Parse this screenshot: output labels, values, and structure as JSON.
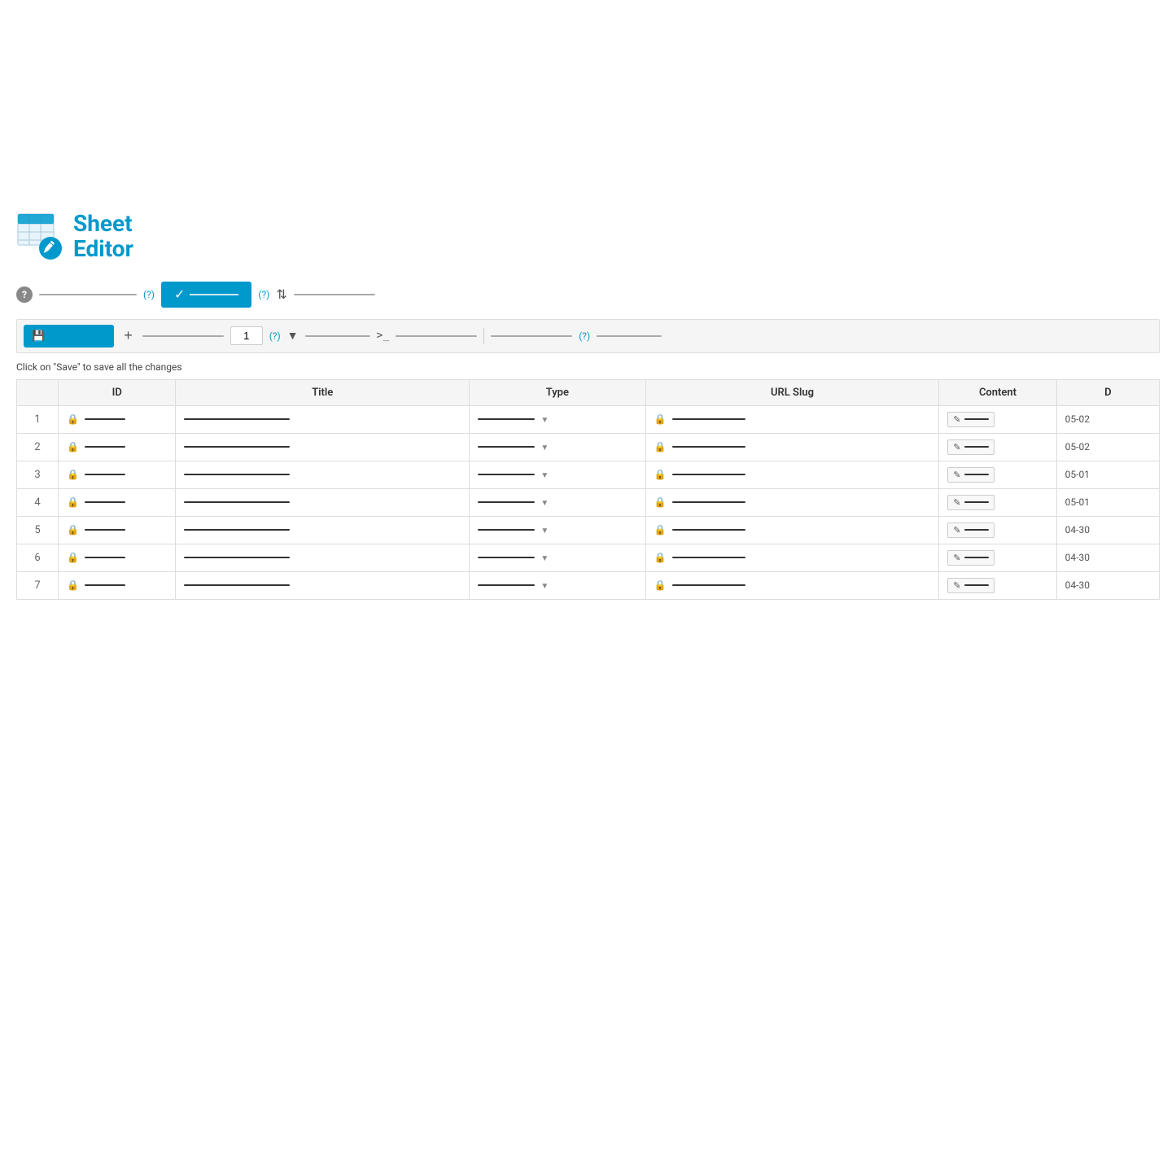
{
  "logo": {
    "title_line1": "Sheet",
    "title_line2": "Editor"
  },
  "toolbar1": {
    "help_icon": "?",
    "help_badge1": "(?)",
    "check_label": "✓",
    "help_badge2": "(?)",
    "sort_icon": "⇅"
  },
  "toolbar2": {
    "save_icon": "💾",
    "add_label": "+",
    "page_value": "1",
    "help_badge": "(?)",
    "filter_label": "▼",
    "code_label": ">_",
    "help_badge2": "(?)"
  },
  "hint": "Click on \"Save\" to save all the changes",
  "table": {
    "headers": [
      "",
      "ID",
      "Title",
      "Type",
      "URL Slug",
      "Content",
      "D"
    ],
    "rows": [
      {
        "num": "1",
        "id": "———",
        "title": "——————————",
        "type": "———",
        "slug": "——————",
        "content": "edit",
        "date": "05-02"
      },
      {
        "num": "2",
        "id": "———",
        "title": "——————————",
        "type": "———",
        "slug": "——————",
        "content": "edit",
        "date": "05-02"
      },
      {
        "num": "3",
        "id": "———",
        "title": "——————————",
        "type": "———",
        "slug": "——————",
        "content": "edit",
        "date": "05-01"
      },
      {
        "num": "4",
        "id": "———",
        "title": "——————————",
        "type": "———",
        "slug": "——————",
        "content": "edit",
        "date": "05-01"
      },
      {
        "num": "5",
        "id": "———",
        "title": "——————————",
        "type": "———",
        "slug": "——————",
        "content": "edit",
        "date": "04-30"
      },
      {
        "num": "6",
        "id": "———",
        "title": "——————————",
        "type": "———",
        "slug": "——————",
        "content": "edit",
        "date": "04-30"
      },
      {
        "num": "7",
        "id": "———",
        "title": "——————————",
        "type": "———",
        "slug": "——————",
        "content": "edit",
        "date": "04-30"
      }
    ]
  }
}
